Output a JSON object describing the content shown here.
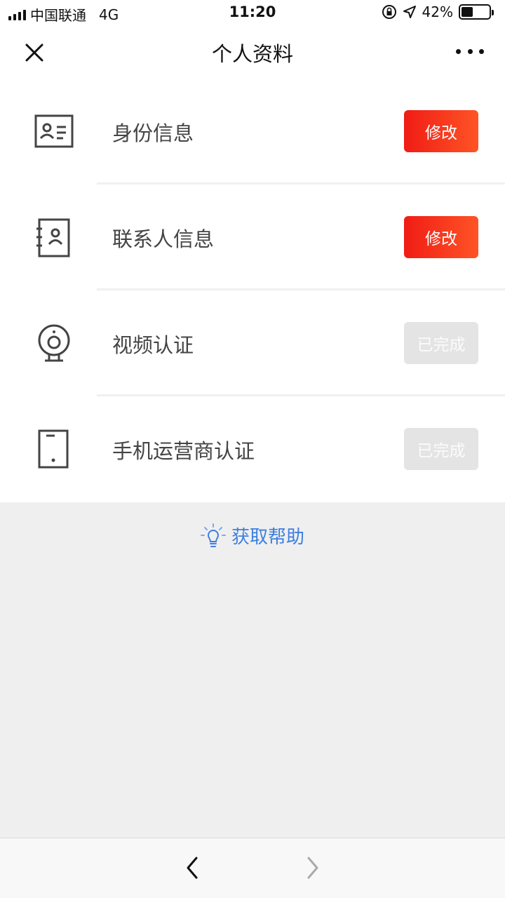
{
  "status": {
    "carrier": "中国联通",
    "network": "4G",
    "time": "11:20",
    "battery": "42%",
    "battery_level": 0.42
  },
  "nav": {
    "title": "个人资料",
    "close_icon": "close-icon",
    "more_icon": "more-icon"
  },
  "rows": [
    {
      "label": "身份信息",
      "button": "修改",
      "icon": "id-card-icon",
      "state": "editable"
    },
    {
      "label": "联系人信息",
      "button": "修改",
      "icon": "contact-book-icon",
      "state": "editable"
    },
    {
      "label": "视频认证",
      "button": "已完成",
      "icon": "webcam-icon",
      "state": "done"
    },
    {
      "label": "手机运营商认证",
      "button": "已完成",
      "icon": "phone-icon",
      "state": "done"
    }
  ],
  "help": {
    "label": "获取帮助",
    "icon": "lightbulb-icon"
  },
  "toolbar": {
    "back_icon": "chevron-left-icon",
    "forward_icon": "chevron-right-icon"
  },
  "colors": {
    "accent_red": "#f01c15",
    "link_blue": "#3d7fe0",
    "done_gray": "#e4e4e4"
  }
}
